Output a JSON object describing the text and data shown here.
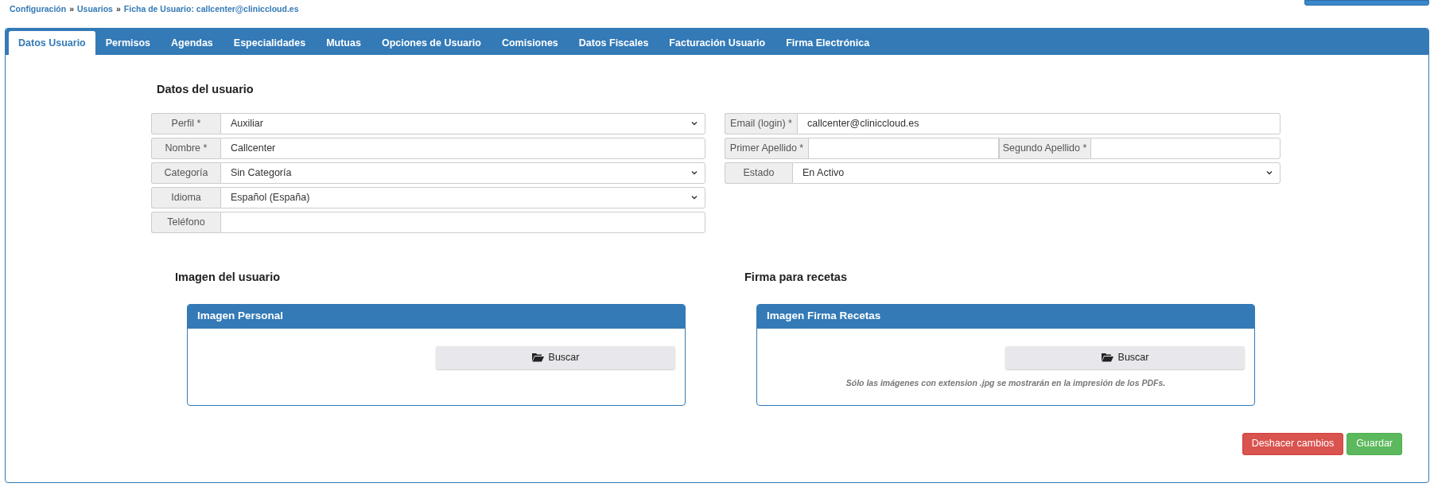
{
  "breadcrumb": {
    "items": [
      "Configuración",
      "Usuarios",
      "Ficha de Usuario: callcenter@cliniccloud.es"
    ],
    "separator": "»"
  },
  "tabs": [
    {
      "label": "Datos Usuario",
      "selected": true
    },
    {
      "label": "Permisos",
      "selected": false
    },
    {
      "label": "Agendas",
      "selected": false
    },
    {
      "label": "Especialidades",
      "selected": false
    },
    {
      "label": "Mutuas",
      "selected": false
    },
    {
      "label": "Opciones de Usuario",
      "selected": false
    },
    {
      "label": "Comisiones",
      "selected": false
    },
    {
      "label": "Datos Fiscales",
      "selected": false
    },
    {
      "label": "Facturación Usuario",
      "selected": false
    },
    {
      "label": "Firma Electrónica",
      "selected": false
    }
  ],
  "user_data": {
    "title": "Datos del usuario",
    "left_rows": [
      {
        "cells": [
          {
            "label": "Perfil *",
            "value": "Auxiliar",
            "kind": "select"
          }
        ]
      },
      {
        "cells": [
          {
            "label": "Nombre *",
            "value": "Callcenter",
            "kind": "input"
          }
        ]
      },
      {
        "cells": [
          {
            "label": "Categoría",
            "value": "Sin Categoría",
            "kind": "select"
          }
        ]
      },
      {
        "cells": [
          {
            "label": "Idioma",
            "value": "Español (España)",
            "kind": "select"
          }
        ]
      },
      {
        "cells": [
          {
            "label": "Teléfono",
            "kind": "input"
          }
        ]
      }
    ],
    "right_rows": [
      {
        "cells": [
          {
            "label": "Email (login) *",
            "value": "callcenter@cliniccloud.es",
            "kind": "input"
          }
        ]
      },
      {
        "cells": [
          {
            "label": "Primer Apellido *",
            "kind": "input"
          },
          {
            "label": "Segundo Apellido *",
            "kind": "input"
          }
        ]
      },
      {
        "cells": [
          {
            "label": "Estado",
            "value": "En Activo",
            "kind": "select"
          }
        ]
      }
    ]
  },
  "images": [
    {
      "title": "Imagen del usuario",
      "panel_title": "Imagen Personal",
      "button": "Buscar"
    },
    {
      "title": "Firma para recetas",
      "panel_title": "Imagen Firma Recetas",
      "button": "Buscar",
      "note": "Sólo las imágenes con extension .jpg se mostrarán en la impresión de los PDFs."
    }
  ],
  "actions": [
    {
      "label": "Deshacer cambios",
      "kind": "danger"
    },
    {
      "label": "Guardar",
      "kind": "success"
    }
  ]
}
